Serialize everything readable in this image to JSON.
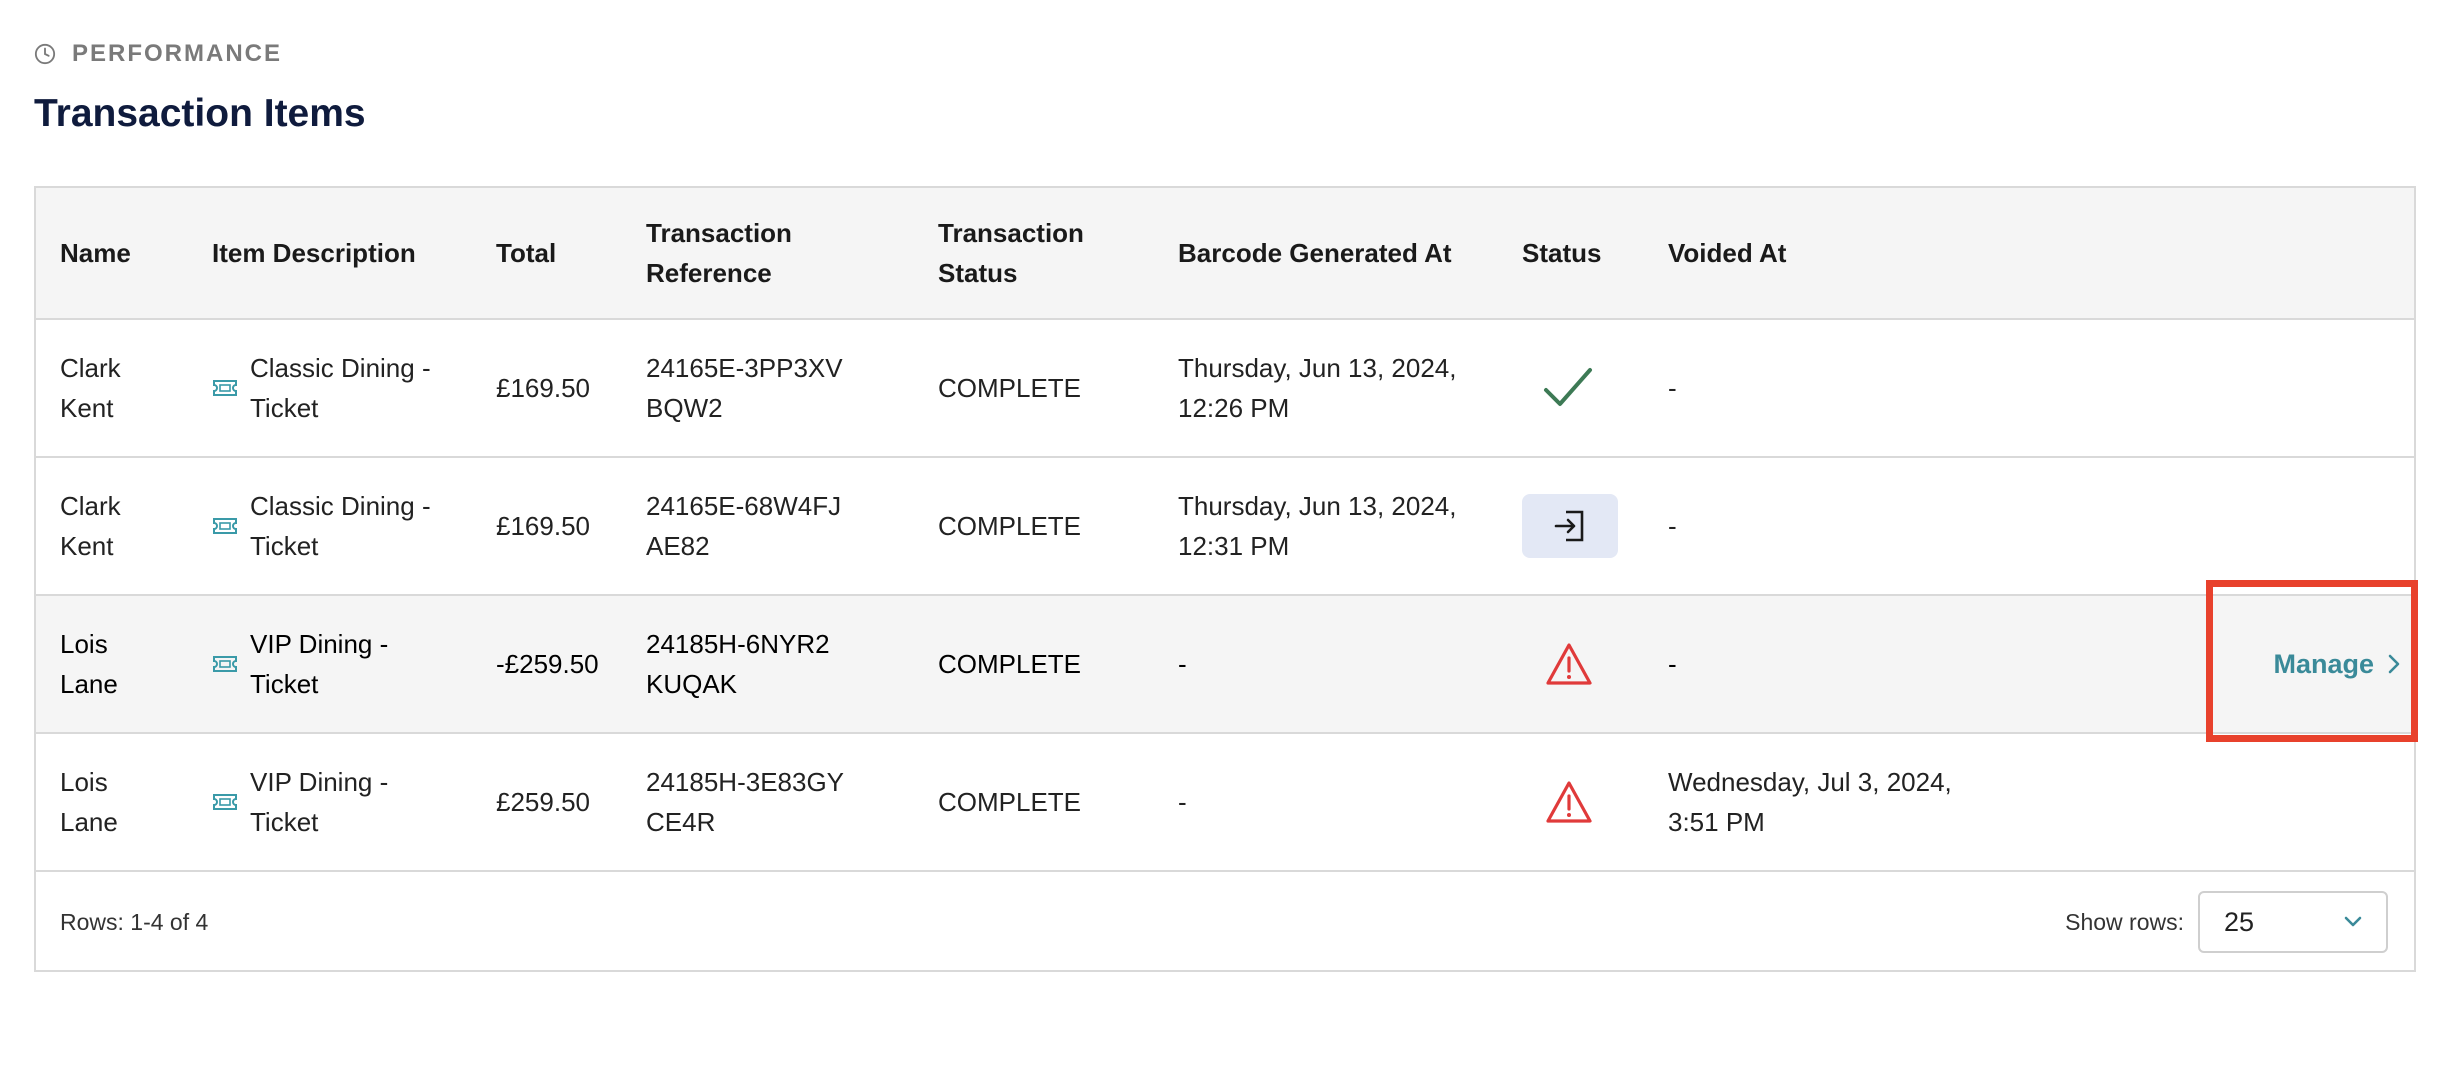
{
  "header": {
    "section_label": "PERFORMANCE",
    "title": "Transaction Items"
  },
  "table": {
    "columns": {
      "name": "Name",
      "description": "Item Description",
      "total": "Total",
      "reference": "Transaction Reference",
      "tx_status": "Transaction Status",
      "barcode": "Barcode Generated At",
      "status": "Status",
      "voided": "Voided At"
    },
    "rows": [
      {
        "name": "Clark Kent",
        "description": "Classic Dining - Ticket",
        "total": "£169.50",
        "reference": "24165E-3PP3XVBQW2",
        "tx_status": "COMPLETE",
        "barcode": "Thursday, Jun 13, 2024, 12:26 PM",
        "status_icon": "check-icon",
        "voided": "-"
      },
      {
        "name": "Clark Kent",
        "description": "Classic Dining - Ticket",
        "total": "£169.50",
        "reference": "24165E-68W4FJAE82",
        "tx_status": "COMPLETE",
        "barcode": "Thursday, Jun 13, 2024, 12:31 PM",
        "status_icon": "sign-in-icon",
        "voided": "-"
      },
      {
        "name": "Lois Lane",
        "description": "VIP Dining - Ticket",
        "total": "-£259.50",
        "reference": "24185H-6NYR2KUQAK",
        "tx_status": "COMPLETE",
        "barcode": "-",
        "status_icon": "warning-icon",
        "voided": "-",
        "action": "Manage"
      },
      {
        "name": "Lois Lane",
        "description": "VIP Dining - Ticket",
        "total": "£259.50",
        "reference": "24185H-3E83GYCE4R",
        "tx_status": "COMPLETE",
        "barcode": "-",
        "status_icon": "warning-icon",
        "voided": "Wednesday, Jul 3, 2024, 3:51 PM"
      }
    ]
  },
  "footer": {
    "rows_count": "Rows: 1-4 of 4",
    "show_rows_label": "Show rows:",
    "show_rows_value": "25"
  },
  "colors": {
    "accent": "#3a8a99",
    "title": "#0f1b3d",
    "success": "#3d7a55",
    "warning": "#e03a3a",
    "highlight": "#e8412c"
  }
}
